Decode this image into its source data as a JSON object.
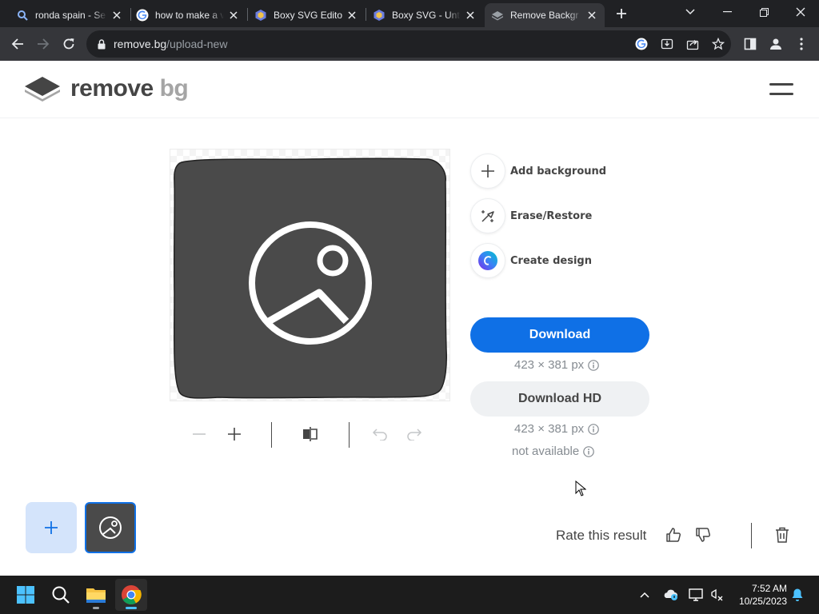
{
  "browser": {
    "tabs": [
      {
        "title": "ronda spain - Se",
        "icon": "search-icon",
        "active": false
      },
      {
        "title": "how to make a v",
        "icon": "google-icon",
        "active": false
      },
      {
        "title": "Boxy SVG Editor",
        "icon": "boxy-svg-icon",
        "active": false
      },
      {
        "title": "Boxy SVG - Unti",
        "icon": "boxy-svg-icon",
        "active": false
      },
      {
        "title": "Remove Backgr",
        "icon": "removebg-icon",
        "active": true
      }
    ],
    "url_domain": "remove.bg",
    "url_path": "/upload-new"
  },
  "site": {
    "logo_main": "remove",
    "logo_accent": "bg"
  },
  "actions": [
    {
      "label": "Add background",
      "icon": "plus-icon"
    },
    {
      "label": "Erase/Restore",
      "icon": "magic-brush-icon"
    },
    {
      "label": "Create design",
      "icon": "canva-icon"
    }
  ],
  "download": {
    "label": "Download",
    "size": "423 × 381 px"
  },
  "download_hd": {
    "label": "Download HD",
    "size": "423 × 381 px",
    "availability": "not available"
  },
  "feedback": {
    "label": "Rate this result"
  },
  "taskbar": {
    "time": "7:52 AM",
    "date": "10/25/2023"
  },
  "colors": {
    "accent": "#0f70e6",
    "accent_light": "#d4e4fb",
    "text": "#454545",
    "muted": "#858b91"
  }
}
